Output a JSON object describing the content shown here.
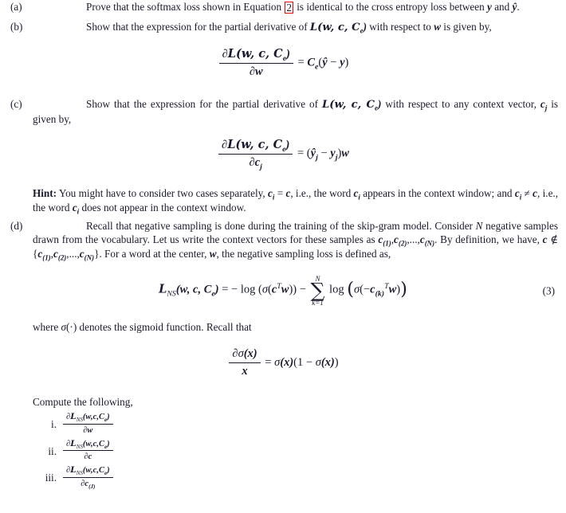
{
  "document": {
    "background_color": "#ffffff",
    "text_color": "#1a1a2e",
    "link_box_color": "#dd0806"
  },
  "parts": {
    "a": {
      "label": "(a)",
      "text_before_ref": "Prove that the softmax loss shown in Equation",
      "equation_ref": "2",
      "text_after_ref": "is identical to the cross entropy loss between",
      "var_y": "y",
      "conjunction": "and",
      "var_yhat": "ŷ",
      "period": "."
    },
    "b": {
      "label": "(b)",
      "text_1": "Show that the expression for the partial derivative of",
      "loss_symbol": "L(w, c, C",
      "loss_sub": "e",
      "loss_close": ")",
      "text_2": "with respect to",
      "var_w": "w",
      "text_3": "is given by,",
      "equation": {
        "numerator_partial": "∂",
        "numerator_body": "L(w, c, C",
        "numerator_sub": "e",
        "numerator_close": ")",
        "denominator_partial": "∂",
        "denominator_var": "w",
        "equals": "=",
        "rhs_C": "C",
        "rhs_C_sub": "e",
        "rhs_open": "(",
        "rhs_yhat": "ŷ",
        "rhs_minus": "−",
        "rhs_y": "y",
        "rhs_close": ")"
      }
    },
    "c": {
      "label": "(c)",
      "text_1": "Show that the expression for the partial derivative of",
      "loss_symbol": "L(w, c, C",
      "loss_sub": "e",
      "loss_close": ")",
      "text_2": "with respect to any context vector,",
      "var_cj": "c",
      "var_cj_sub": "j",
      "text_3": "is given by,",
      "equation": {
        "numerator_partial": "∂",
        "numerator_body": "L(w, c, C",
        "numerator_sub": "e",
        "numerator_close": ")",
        "denominator_partial": "∂",
        "denominator_var": "c",
        "denominator_sub": "j",
        "equals": "=",
        "rhs_open": "(",
        "rhs_yhat": "ŷ",
        "rhs_yhat_sub": "j",
        "rhs_minus": "−",
        "rhs_y": "y",
        "rhs_y_sub": "j",
        "rhs_close": ")",
        "rhs_w": "w"
      }
    },
    "hint": {
      "title": "Hint:",
      "text_1": "You might have to consider two cases separately,",
      "ci_1": "c",
      "ci_1_sub": "i",
      "eq_sign": "=",
      "c_1": "c",
      "text_2": ", i.e., the word",
      "ci_2": "c",
      "ci_2_sub": "i",
      "text_3": "appears in the context window; and",
      "ci_3": "c",
      "ci_3_sub": "i",
      "neq_sign": "≠",
      "c_2": "c",
      "text_4": ", i.e., the word",
      "ci_4": "c",
      "ci_4_sub": "i",
      "text_5": "does not appear in the context window."
    },
    "d": {
      "label": "(d)",
      "text_1": "Recall that negative sampling is done during the training of the skip-gram model. Consider",
      "var_N": "N",
      "text_2": "negative samples drawn from the vocabulary. Let us write the context vectors for these samples as",
      "c1": "c",
      "c1_sub": "(1)",
      "c2": "c",
      "c2_sub": "(2)",
      "ellipsis": ",...,",
      "cN": "c",
      "cN_sub": "(N)",
      "text_3": ". By definition, we have,",
      "var_c": "c",
      "notin": "∉",
      "set_open": "{",
      "set_c1": "c",
      "set_c1_sub": "(1)",
      "set_c2": "c",
      "set_c2_sub": "(2)",
      "set_ellipsis": ",...,",
      "set_cN": "c",
      "set_cN_sub": "(N)",
      "set_close": "}",
      "text_4": ". For a word at the center,",
      "var_w": "w",
      "text_5": ", the negative sampling loss is defined as,",
      "equation": {
        "number": "(3)",
        "lhs_L": "L",
        "lhs_NS": "NS",
        "lhs_args": "(w, c, C",
        "lhs_args_sub": "e",
        "lhs_args_close": ")",
        "equals": "=",
        "minus_1": "−",
        "log_1": "log",
        "sigma": "σ",
        "cT": "c",
        "cT_sup": "T",
        "w_1": "w",
        "minus_2": "−",
        "sum_top": "N",
        "sum_symbol": "∑",
        "sum_bottom": "k=1",
        "log_2": "log",
        "sigma_2": "σ",
        "neg": "−",
        "ck": "c",
        "ck_sub": "(k)",
        "ck_sup": "T",
        "w_2": "w"
      }
    },
    "sigmoid_note": {
      "text_1": "where",
      "sigma": "σ",
      "dot_arg": "(·)",
      "text_2": "denotes the sigmoid function. Recall that",
      "equation": {
        "numerator_partial": "∂",
        "numerator_sigma": "σ",
        "numerator_arg": "(x)",
        "denominator_var": "x",
        "equals": "=",
        "rhs_sigma_1": "σ",
        "rhs_arg_1": "(x)",
        "rhs_open": "(1",
        "rhs_minus": "−",
        "rhs_sigma_2": "σ",
        "rhs_arg_2": "(x)",
        "rhs_close": ")"
      }
    },
    "compute": {
      "heading": "Compute the following,",
      "items": [
        {
          "label": "i.",
          "num_partial": "∂",
          "num_L": "L",
          "num_NS": "NS",
          "num_args": "(w,c,C",
          "num_args_sub": "e",
          "num_args_close": ")",
          "den_partial": "∂",
          "den_var": "w",
          "den_sub": ""
        },
        {
          "label": "ii.",
          "num_partial": "∂",
          "num_L": "L",
          "num_NS": "NS",
          "num_args": "(w,c,C",
          "num_args_sub": "e",
          "num_args_close": ")",
          "den_partial": "∂",
          "den_var": "c",
          "den_sub": ""
        },
        {
          "label": "iii.",
          "num_partial": "∂",
          "num_L": "L",
          "num_NS": "NS",
          "num_args": "(w,c,C",
          "num_args_sub": "e",
          "num_args_close": ")",
          "den_partial": "∂",
          "den_var": "c",
          "den_sub": "(J)"
        }
      ]
    }
  }
}
